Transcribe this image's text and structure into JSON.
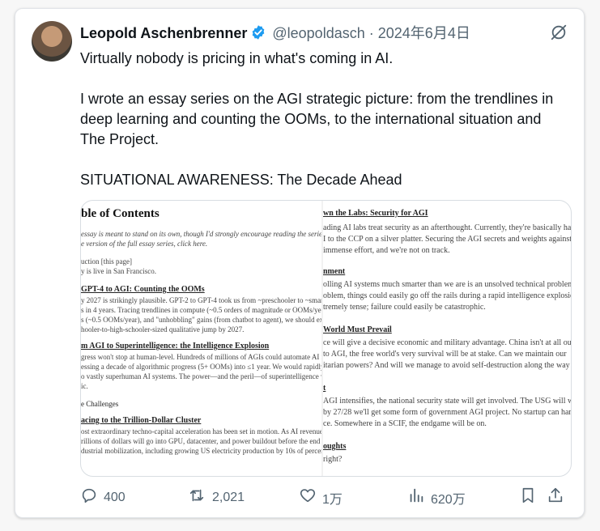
{
  "tweet": {
    "author_name": "Leopold Aschenbrenner",
    "handle": "@leopoldasch",
    "separator": "·",
    "date": "2024年6月4日",
    "paragraphs": [
      "Virtually nobody is pricing in what's coming in AI.",
      "I wrote an essay series on the AGI strategic picture: from the trendlines in deep learning and counting the OOMs, to the international situation and The Project.",
      "SITUATIONAL AWARENESS: The Decade Ahead"
    ]
  },
  "doc_image": {
    "left": [
      "ble of Contents",
      "essay is meant to stand on its own, though I'd strongly encourage reading the series as a whole",
      "e version of the full essay series, click here.",
      "uction [this page]",
      "y is live in San Francisco.",
      "GPT-4 to AGI: Counting the OOMs",
      "y 2027 is strikingly plausible. GPT-2 to GPT-4 took us from ~preschooler to ~smart high-scho",
      "s in 4 years. Tracing trendlines in compute (~0.5 orders of magnitude or OOMs/year), algorit",
      "s (~0.5 OOMs/year), and \"unhobbling\" gains (from chatbot to agent), we should expect a",
      "hooler-to-high-schooler-sized qualitative jump by 2027.",
      "m AGI to Superintelligence: the Intelligence Explosion",
      "gress won't stop at human-level. Hundreds of millions of AGIs could automate AI research,",
      "essing a decade of algorithmic progress (5+ OOMs) into ≤1 year. We would rapidly go from h",
      "o vastly superhuman AI systems. The power—and the peril—of superintelligence would be",
      "ic.",
      "e Challenges",
      "acing to the Trillion-Dollar Cluster",
      "ost extraordinary techno-capital acceleration has been set in motion. As AI revenue grows rap",
      "rillions of dollars will go into GPU, datacenter, and power buildout before the end of the de",
      "dustrial mobilization, including growing US electricity production by 10s of percent, will be"
    ],
    "right": [
      "wn the Labs: Security for AGI",
      "ading AI labs treat security as an afterthought. Currently, they're basically ha",
      "I to the CCP on a silver platter. Securing the AGI secrets and weights against",
      "immense effort, and we're not on track.",
      "nment",
      "olling AI systems much smarter than we are is an unsolved technical problem",
      "oblem, things could easily go off the rails during a rapid intelligence explosio",
      "tremely tense; failure could easily be catastrophic.",
      "World Must Prevail",
      "ce will give a decisive economic and military advantage. China isn't at all out",
      "to AGI, the free world's very survival will be at stake. Can we maintain our",
      "itarian powers? And will we manage to avoid self-destruction along the way",
      "t",
      "AGI intensifies, the national security state will get involved. The USG will w",
      "by 27/28 we'll get some form of government AGI project. No startup can han",
      "ce. Somewhere in a SCIF, the endgame will be on.",
      "oughts",
      "right?"
    ]
  },
  "actions": {
    "replies": "400",
    "reposts": "2,021",
    "likes": "1万",
    "views": "620万"
  },
  "colors": {
    "verified": "#1d9bf0",
    "muted_text": "#536471",
    "text": "#0f1419"
  },
  "icons": [
    "verified-icon",
    "mute-icon",
    "reply-icon",
    "repost-icon",
    "like-icon",
    "views-icon",
    "bookmark-icon",
    "share-icon"
  ]
}
